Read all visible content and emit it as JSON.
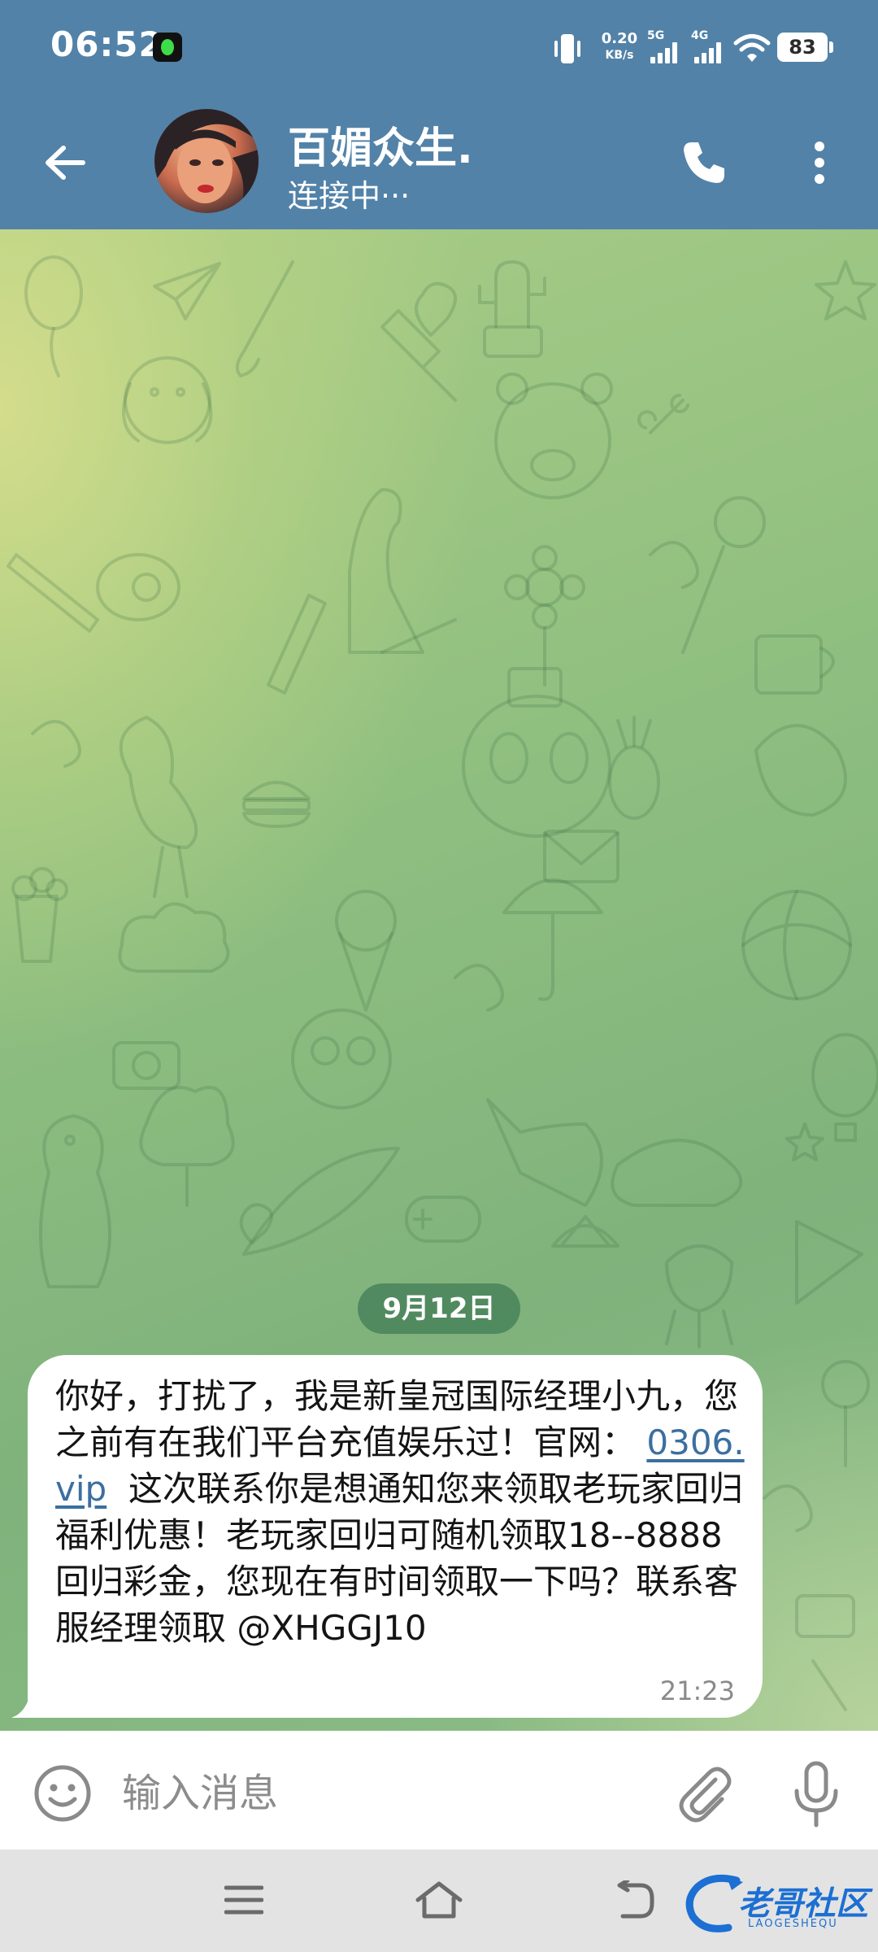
{
  "status_bar": {
    "time": "06:52",
    "net_speed_value": "0.20",
    "net_speed_unit": "KB/s",
    "sim1_type": "5G",
    "sim2_type": "4G",
    "battery_level": "83"
  },
  "header": {
    "chat_title": "百媚众生.",
    "chat_status": "连接中···"
  },
  "chat": {
    "date_separator": "9月12日",
    "message": {
      "text_before_link": "你好，打扰了，我是新皇冠国际经理小九，您之前有在我们平台充值娱乐过！官网：",
      "link_text": "0306.vip",
      "text_after_link": "这次联系你是想通知您来领取老玩家回归福利优惠！老玩家回归可随机领取18--8888回归彩金，您现在有时间领取一下吗？联系客服经理领取 @XHGGJ10",
      "time": "21:23"
    }
  },
  "input_bar": {
    "placeholder": "输入消息"
  },
  "watermark": {
    "text": "老哥社区",
    "subtext": "LAOGESHEQU"
  },
  "colors": {
    "header_bg": "#5282a8",
    "date_chip_bg": "#3e7a54",
    "link": "#3b6fa0",
    "watermark": "#1c6fd3"
  }
}
